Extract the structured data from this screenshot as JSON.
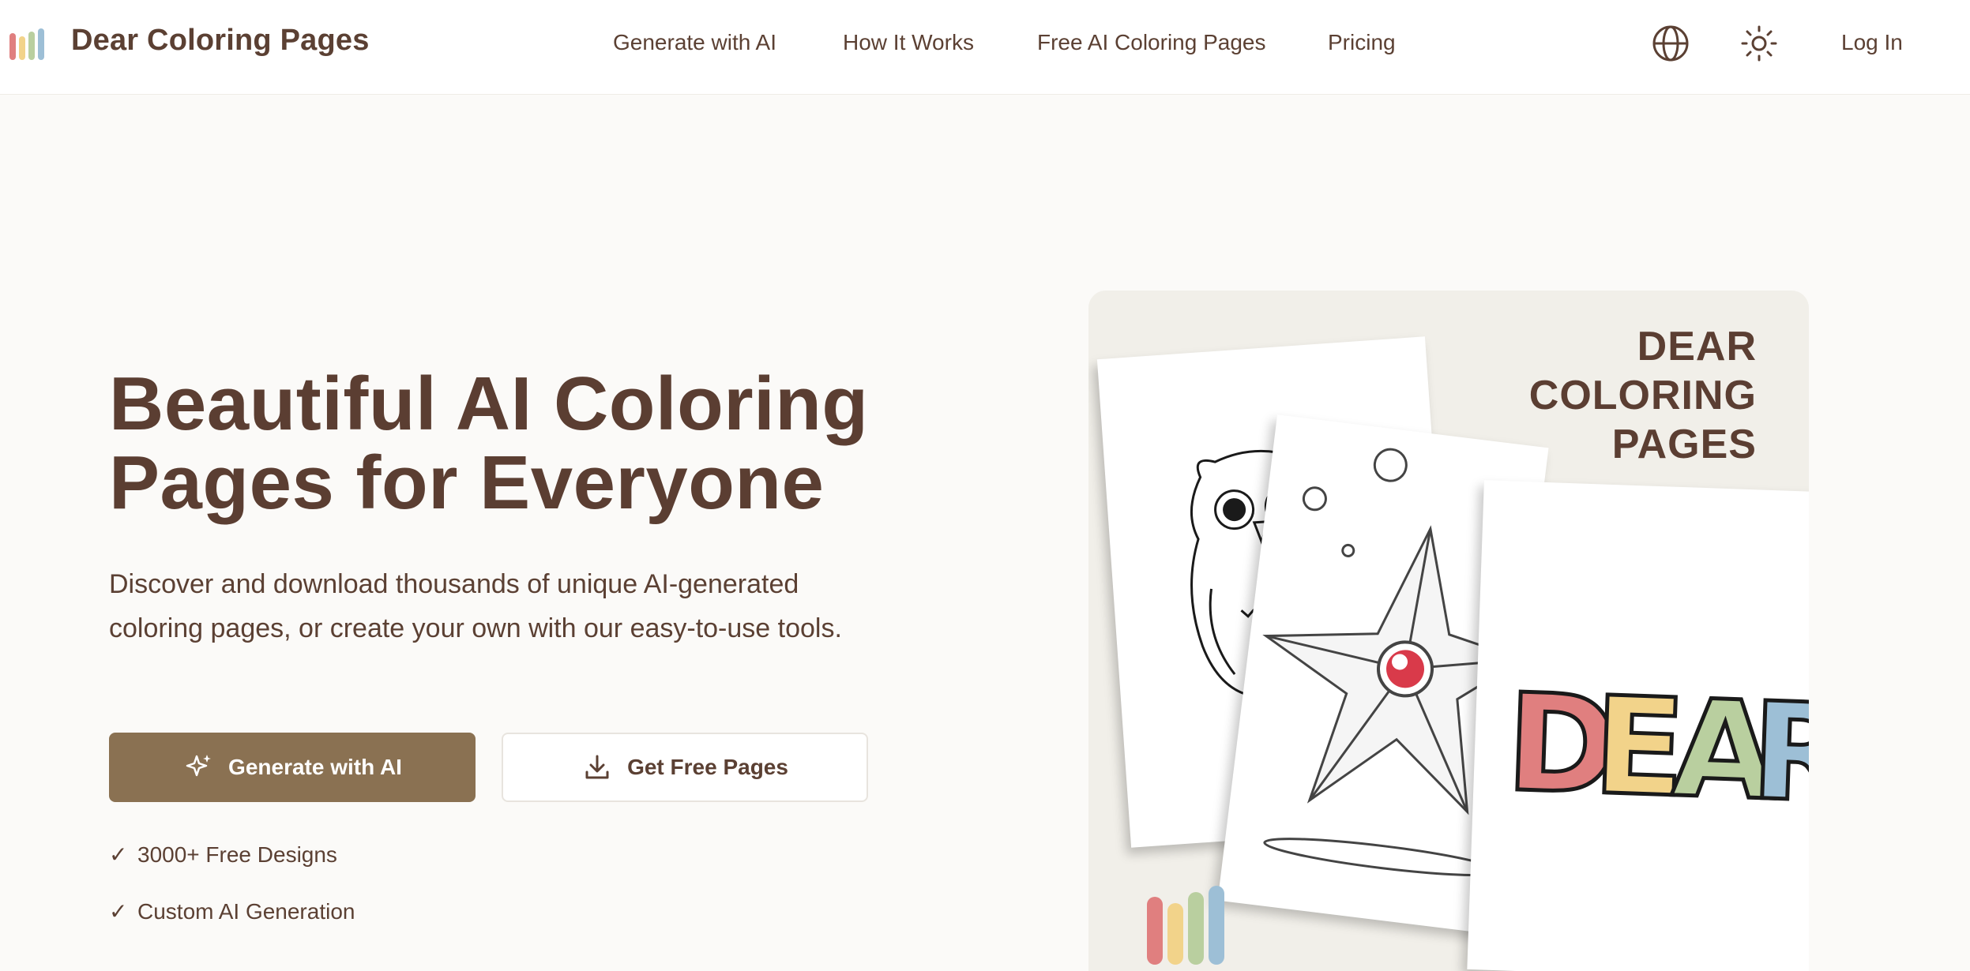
{
  "header": {
    "brand": "Dear Coloring Pages",
    "nav": [
      "Generate with AI",
      "How It Works",
      "Free AI Coloring Pages",
      "Pricing"
    ],
    "login": "Log In",
    "icons": [
      "globe-icon",
      "sun-icon"
    ]
  },
  "hero": {
    "title_line1": "Beautiful AI Coloring",
    "title_line2": "Pages for Everyone",
    "description": "Discover and download thousands of unique AI-generated coloring pages, or create your own with our easy-to-use tools.",
    "primary_button": "Generate with AI",
    "secondary_button": "Get Free Pages",
    "features": [
      "3000+ Free Designs",
      "Custom AI Generation"
    ],
    "check_glyph": "✓"
  },
  "card": {
    "title_lines": [
      "DEAR",
      "COLORING",
      "PAGES"
    ],
    "word": "DEAR"
  },
  "colors": {
    "brand_text": "#5b4033",
    "primary_button": "#8a7152",
    "bar_red": "#e07f7f",
    "bar_yellow": "#f2d38a",
    "bar_green": "#b9cf9f",
    "bar_blue": "#9dbfd6"
  }
}
